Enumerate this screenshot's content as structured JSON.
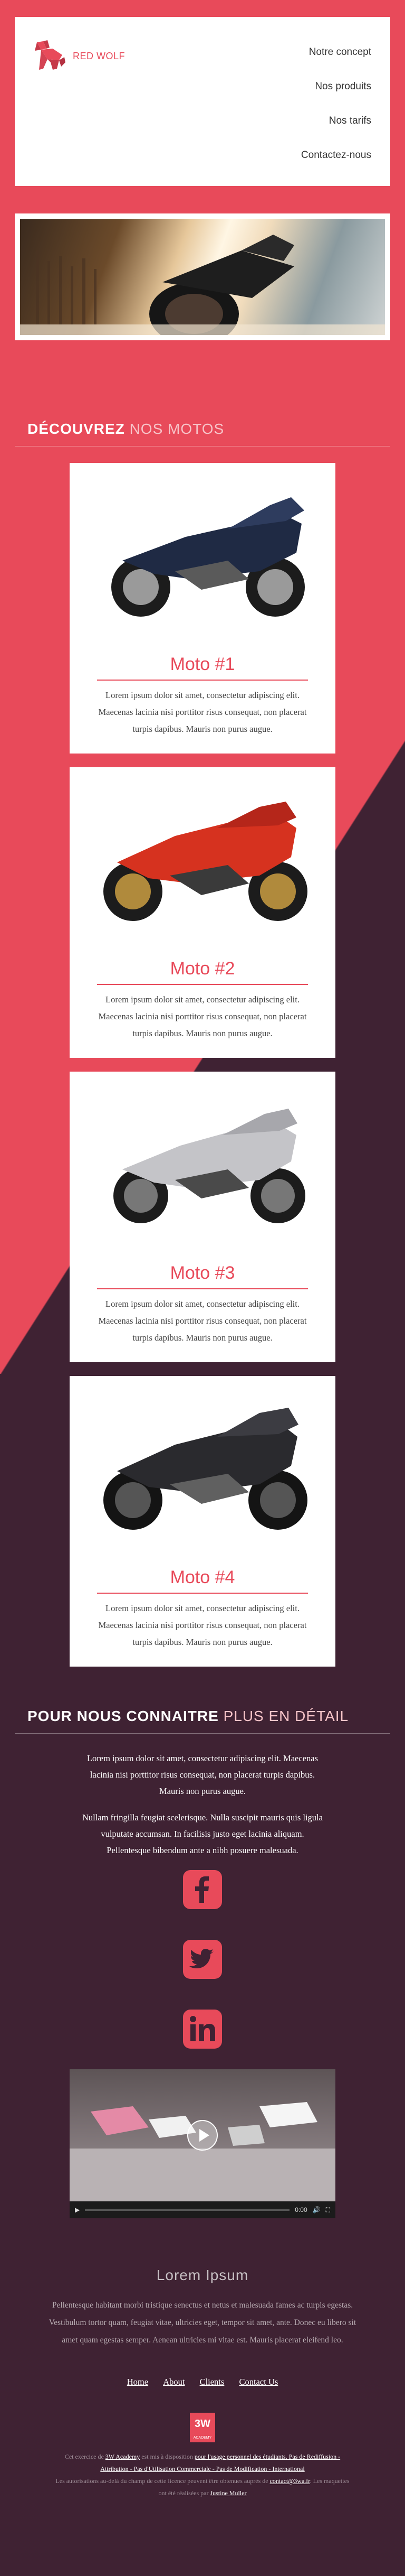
{
  "brand": {
    "name": "RED WOLF"
  },
  "nav": [
    "Notre concept",
    "Nos produits",
    "Nos tarifs",
    "Contactez-nous"
  ],
  "sections": {
    "motos": {
      "bold": "DÉCOUVREZ",
      "light": "NOS MOTOS"
    },
    "about": {
      "bold": "POUR NOUS CONNAITRE",
      "light": "PLUS EN DÉTAIL"
    }
  },
  "cards": [
    {
      "title": "Moto #1",
      "text": "Lorem ipsum dolor sit amet, consectetur adipiscing elit. Maecenas lacinia nisi porttitor risus consequat, non placerat turpis dapibus. Mauris non purus augue."
    },
    {
      "title": "Moto #2",
      "text": "Lorem ipsum dolor sit amet, consectetur adipiscing elit. Maecenas lacinia nisi porttitor risus consequat, non placerat turpis dapibus. Mauris non purus augue."
    },
    {
      "title": "Moto #3",
      "text": "Lorem ipsum dolor sit amet, consectetur adipiscing elit. Maecenas lacinia nisi porttitor risus consequat, non placerat turpis dapibus. Mauris non purus augue."
    },
    {
      "title": "Moto #4",
      "text": "Lorem ipsum dolor sit amet, consectetur adipiscing elit. Maecenas lacinia nisi porttitor risus consequat, non placerat turpis dapibus. Mauris non purus augue."
    }
  ],
  "about": {
    "p1": "Lorem ipsum dolor sit amet, consectetur adipiscing elit. Maecenas lacinia nisi porttitor risus consequat, non placerat turpis dapibus. Mauris non purus augue.",
    "p2": "Nullam fringilla feugiat scelerisque. Nulla suscipit mauris quis ligula vulputate accumsan. In facilisis justo eget lacinia aliquam. Pellentesque bibendum ante a nibh posuere malesuada."
  },
  "social": [
    "facebook-icon",
    "twitter-icon",
    "linkedin-icon"
  ],
  "video": {
    "time": "0:00"
  },
  "lorem": {
    "title": "Lorem Ipsum",
    "text": "Pellentesque habitant morbi tristique senectus et netus et malesuada fames ac turpis egestas. Vestibulum tortor quam, feugiat vitae, ultricies eget, tempor sit amet, ante. Donec eu libero sit amet quam egestas semper. Aenean ultricies mi vitae est. Mauris placerat eleifend leo."
  },
  "footer_nav": [
    "Home",
    "About",
    "Clients",
    "Contact Us"
  ],
  "badge": {
    "main": "3W",
    "sub": "ACADEMY"
  },
  "footer": {
    "line1_a": "Cet exercice de",
    "line1_link1": "3W Academy",
    "line1_b": "est mis à disposition",
    "line1_link2": "pour l'usage personnel des étudiants. Pas de Rediffusion - Attribution - Pas d'Utilisation Commerciale - Pas de Modification - International",
    "line2_a": "Les autorisations au-delà du champ de cette licence peuvent être obtenues auprès de",
    "line2_link": "contact@3wa.fr",
    "line2_b": ". Les maquettes ont été réalisées par",
    "line2_author": "Justine Muller"
  },
  "colors": {
    "accent": "#e84a5a",
    "dark": "#3f2233"
  }
}
